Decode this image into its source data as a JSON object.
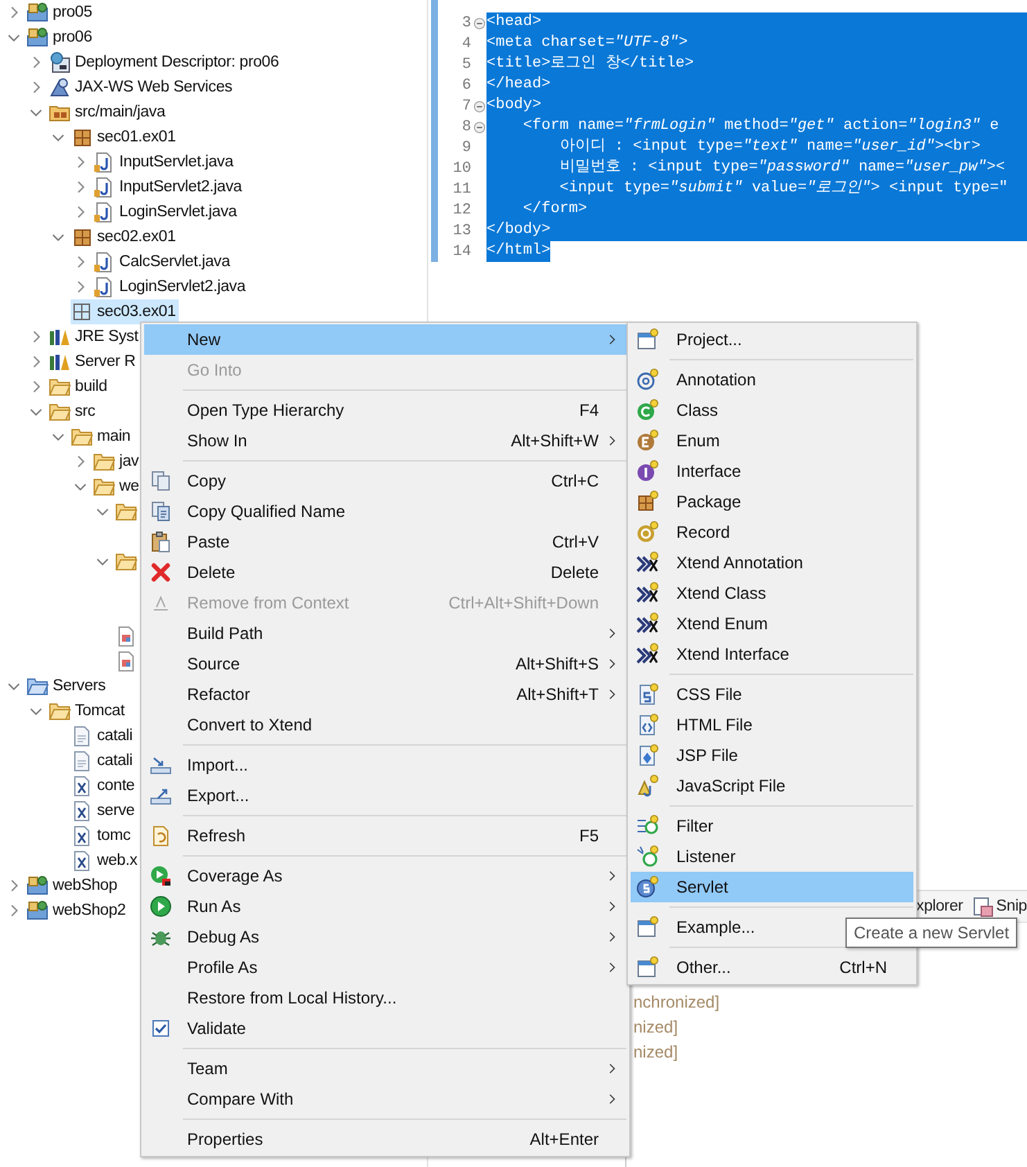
{
  "tree": {
    "items": [
      {
        "label": "pro05",
        "kind": "project",
        "expanded": false,
        "selected": false
      },
      {
        "label": "pro06",
        "kind": "project",
        "expanded": true,
        "selected": false,
        "children": [
          {
            "label": "Deployment Descriptor: pro06",
            "kind": "deploy",
            "expanded": false,
            "selected": false
          },
          {
            "label": "JAX-WS Web Services",
            "kind": "webservices",
            "expanded": false,
            "selected": false
          },
          {
            "label": "src/main/java",
            "kind": "srcfolder",
            "expanded": true,
            "selected": false,
            "children": [
              {
                "label": "sec01.ex01",
                "kind": "package",
                "expanded": true,
                "selected": false,
                "children": [
                  {
                    "label": "InputServlet.java",
                    "kind": "java",
                    "expanded": false,
                    "selected": false
                  },
                  {
                    "label": "InputServlet2.java",
                    "kind": "java",
                    "expanded": false,
                    "selected": false
                  },
                  {
                    "label": "LoginServlet.java",
                    "kind": "java",
                    "expanded": false,
                    "selected": false
                  }
                ]
              },
              {
                "label": "sec02.ex01",
                "kind": "package",
                "expanded": true,
                "selected": false,
                "children": [
                  {
                    "label": "CalcServlet.java",
                    "kind": "java",
                    "expanded": false,
                    "selected": false
                  },
                  {
                    "label": "LoginServlet2.java",
                    "kind": "java",
                    "expanded": false,
                    "selected": false
                  }
                ]
              },
              {
                "label": "sec03.ex01",
                "kind": "emptypackage",
                "selected": true
              }
            ]
          },
          {
            "label": "JRE Syst",
            "kind": "library",
            "expanded": false,
            "selected": false
          },
          {
            "label": "Server R",
            "kind": "library",
            "expanded": false,
            "selected": false
          },
          {
            "label": "build",
            "kind": "folder",
            "expanded": false,
            "selected": false
          },
          {
            "label": "src",
            "kind": "folder",
            "expanded": true,
            "selected": false,
            "children": [
              {
                "label": "main",
                "kind": "folder",
                "expanded": true,
                "selected": false,
                "children": [
                  {
                    "label": "jav",
                    "kind": "folder",
                    "expanded": false,
                    "selected": false
                  },
                  {
                    "label": "we",
                    "kind": "folder",
                    "expanded": true,
                    "selected": false,
                    "children": [
                      {
                        "kind": "folder",
                        "expanded": true,
                        "selected": false
                      },
                      {
                        "kind": "folder",
                        "expanded": true,
                        "selected": false
                      },
                      {
                        "kind": "webfile",
                        "selected": false
                      },
                      {
                        "kind": "webfile",
                        "selected": false
                      }
                    ]
                  }
                ]
              }
            ]
          }
        ]
      },
      {
        "label": "Servers",
        "kind": "serversfolder",
        "expanded": true,
        "selected": false,
        "children": [
          {
            "label": "Tomcat",
            "kind": "folder",
            "expanded": true,
            "selected": false,
            "children": [
              {
                "label": "catali",
                "kind": "file",
                "selected": false
              },
              {
                "label": "catali",
                "kind": "file",
                "selected": false
              },
              {
                "label": "conte",
                "kind": "xml",
                "selected": false
              },
              {
                "label": "serve",
                "kind": "xml",
                "selected": false
              },
              {
                "label": "tomc",
                "kind": "xml",
                "selected": false
              },
              {
                "label": "web.x",
                "kind": "xml",
                "selected": false
              }
            ]
          }
        ]
      },
      {
        "label": "webShop",
        "kind": "project",
        "expanded": false,
        "selected": false
      },
      {
        "label": "webShop2",
        "kind": "project",
        "expanded": false,
        "selected": false
      }
    ]
  },
  "editor": {
    "lines": [
      {
        "number": "3",
        "fold": true,
        "selected": true,
        "to_line_end": true,
        "code": "<head>"
      },
      {
        "number": "4",
        "fold": false,
        "selected": true,
        "to_line_end": true,
        "code": "<meta charset=*\"UTF-8\"*>"
      },
      {
        "number": "5",
        "fold": false,
        "selected": true,
        "to_line_end": true,
        "code": "<title>로그인 창</title>"
      },
      {
        "number": "6",
        "fold": false,
        "selected": true,
        "to_line_end": true,
        "code": "</head>"
      },
      {
        "number": "7",
        "fold": true,
        "selected": true,
        "to_line_end": true,
        "code": "<body>"
      },
      {
        "number": "8",
        "fold": true,
        "selected": true,
        "to_line_end": true,
        "code": "    <form name=*\"frmLogin\"* method=*\"get\"* action=*\"login3\"* e"
      },
      {
        "number": "9",
        "fold": false,
        "selected": true,
        "to_line_end": true,
        "code": "        아이디 : <input type=*\"text\"* name=*\"user_id\"*><br>"
      },
      {
        "number": "10",
        "fold": false,
        "selected": true,
        "to_line_end": true,
        "code": "        비밀번호 : <input type=*\"password\"* name=*\"user_pw\"*><"
      },
      {
        "number": "11",
        "fold": false,
        "selected": true,
        "to_line_end": true,
        "code": "        <input type=*\"submit\"* value=*\"로그인\"*> <input type=\""
      },
      {
        "number": "12",
        "fold": false,
        "selected": true,
        "to_line_end": true,
        "code": "    </form>"
      },
      {
        "number": "13",
        "fold": false,
        "selected": true,
        "to_line_end": true,
        "code": "</body>"
      },
      {
        "number": "14",
        "fold": false,
        "selected": true,
        "to_line_end": false,
        "code": "</html>"
      }
    ]
  },
  "bottom_panel": {
    "tabs": [
      {
        "label": "xplorer"
      },
      {
        "label": "Snip"
      }
    ],
    "lines": [
      "nchronized]",
      "nized]",
      "nized]"
    ]
  },
  "context_menu": {
    "groups": [
      {
        "items": [
          {
            "label": "New",
            "kind": "command",
            "selected": true,
            "disabled": false,
            "submenu": true
          },
          {
            "label": "Go Into",
            "kind": "command",
            "selected": false,
            "disabled": true,
            "submenu": false
          }
        ]
      },
      {
        "items": [
          {
            "label": "Open Type Hierarchy",
            "shortcut": "F4",
            "kind": "command",
            "selected": false,
            "disabled": false,
            "submenu": false
          },
          {
            "label": "Show In",
            "shortcut": "Alt+Shift+W",
            "kind": "command",
            "selected": false,
            "disabled": false,
            "submenu": true
          }
        ]
      },
      {
        "items": [
          {
            "label": "Copy",
            "shortcut": "Ctrl+C",
            "kind": "command",
            "selected": false,
            "disabled": false,
            "submenu": false
          },
          {
            "label": "Copy Qualified Name",
            "kind": "command",
            "selected": false,
            "disabled": false,
            "submenu": false
          },
          {
            "label": "Paste",
            "shortcut": "Ctrl+V",
            "kind": "command",
            "selected": false,
            "disabled": false,
            "submenu": false
          },
          {
            "label": "Delete",
            "shortcut": "Delete",
            "kind": "command",
            "selected": false,
            "disabled": false,
            "submenu": false
          },
          {
            "label": "Remove from Context",
            "shortcut": "Ctrl+Alt+Shift+Down",
            "kind": "command",
            "selected": false,
            "disabled": true,
            "submenu": false
          },
          {
            "label": "Build Path",
            "kind": "command",
            "selected": false,
            "disabled": false,
            "submenu": true
          },
          {
            "label": "Source",
            "shortcut": "Alt+Shift+S",
            "kind": "command",
            "selected": false,
            "disabled": false,
            "submenu": true
          },
          {
            "label": "Refactor",
            "shortcut": "Alt+Shift+T",
            "kind": "command",
            "selected": false,
            "disabled": false,
            "submenu": true
          },
          {
            "label": "Convert to Xtend",
            "kind": "command",
            "selected": false,
            "disabled": false,
            "submenu": false
          }
        ]
      },
      {
        "items": [
          {
            "label": "Import...",
            "kind": "command",
            "selected": false,
            "disabled": false,
            "submenu": false
          },
          {
            "label": "Export...",
            "kind": "command",
            "selected": false,
            "disabled": false,
            "submenu": false
          }
        ]
      },
      {
        "items": [
          {
            "label": "Refresh",
            "shortcut": "F5",
            "kind": "command",
            "selected": false,
            "disabled": false,
            "submenu": false
          }
        ]
      },
      {
        "items": [
          {
            "label": "Coverage As",
            "kind": "command",
            "selected": false,
            "disabled": false,
            "submenu": true
          },
          {
            "label": "Run As",
            "kind": "command",
            "selected": false,
            "disabled": false,
            "submenu": true
          },
          {
            "label": "Debug As",
            "kind": "command",
            "selected": false,
            "disabled": false,
            "submenu": true
          },
          {
            "label": "Profile As",
            "kind": "command",
            "selected": false,
            "disabled": false,
            "submenu": true
          },
          {
            "label": "Restore from Local History...",
            "kind": "command",
            "selected": false,
            "disabled": false,
            "submenu": false
          },
          {
            "label": "Validate",
            "kind": "check",
            "checked": true,
            "selected": false,
            "disabled": false,
            "submenu": false
          }
        ]
      },
      {
        "items": [
          {
            "label": "Team",
            "kind": "command",
            "selected": false,
            "disabled": false,
            "submenu": true
          },
          {
            "label": "Compare With",
            "kind": "command",
            "selected": false,
            "disabled": false,
            "submenu": true
          }
        ]
      },
      {
        "items": [
          {
            "label": "Properties",
            "shortcut": "Alt+Enter",
            "kind": "command",
            "selected": false,
            "disabled": false,
            "submenu": false
          }
        ]
      }
    ]
  },
  "new_submenu": {
    "groups": [
      {
        "items": [
          {
            "label": "Project...",
            "selected": false
          }
        ]
      },
      {
        "items": [
          {
            "label": "Annotation",
            "selected": false
          },
          {
            "label": "Class",
            "selected": false
          },
          {
            "label": "Enum",
            "selected": false
          },
          {
            "label": "Interface",
            "selected": false
          },
          {
            "label": "Package",
            "selected": false
          },
          {
            "label": "Record",
            "selected": false
          },
          {
            "label": "Xtend Annotation",
            "selected": false
          },
          {
            "label": "Xtend Class",
            "selected": false
          },
          {
            "label": "Xtend Enum",
            "selected": false
          },
          {
            "label": "Xtend Interface",
            "selected": false
          }
        ]
      },
      {
        "items": [
          {
            "label": "CSS File",
            "selected": false
          },
          {
            "label": "HTML File",
            "selected": false
          },
          {
            "label": "JSP File",
            "selected": false
          },
          {
            "label": "JavaScript File",
            "selected": false
          }
        ]
      },
      {
        "items": [
          {
            "label": "Filter",
            "selected": false
          },
          {
            "label": "Listener",
            "selected": false
          },
          {
            "label": "Servlet",
            "selected": true
          }
        ]
      },
      {
        "items": [
          {
            "label": "Example...",
            "selected": false
          }
        ]
      },
      {
        "items": [
          {
            "label": "Other...",
            "shortcut": "Ctrl+N",
            "selected": false
          }
        ]
      }
    ]
  },
  "tooltip": {
    "text": "Create a new Servlet"
  }
}
